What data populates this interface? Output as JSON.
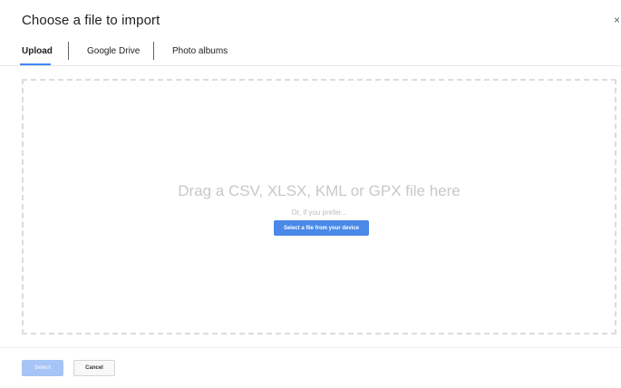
{
  "dialog": {
    "title": "Choose a file to import",
    "close_glyph": "×"
  },
  "tabs": [
    {
      "label": "Upload",
      "active": true
    },
    {
      "label": "Google Drive",
      "active": false
    },
    {
      "label": "Photo albums",
      "active": false
    }
  ],
  "dropzone": {
    "title": "Drag a CSV, XLSX, KML or GPX file here",
    "subtitle": "Or, if you prefer...",
    "button_label": "Select a file from your device"
  },
  "footer": {
    "select_label": "Select",
    "cancel_label": "Cancel"
  },
  "colors": {
    "accent": "#4285f4",
    "primary_button": "#4a89e8",
    "disabled_button": "#a6c4f6"
  }
}
